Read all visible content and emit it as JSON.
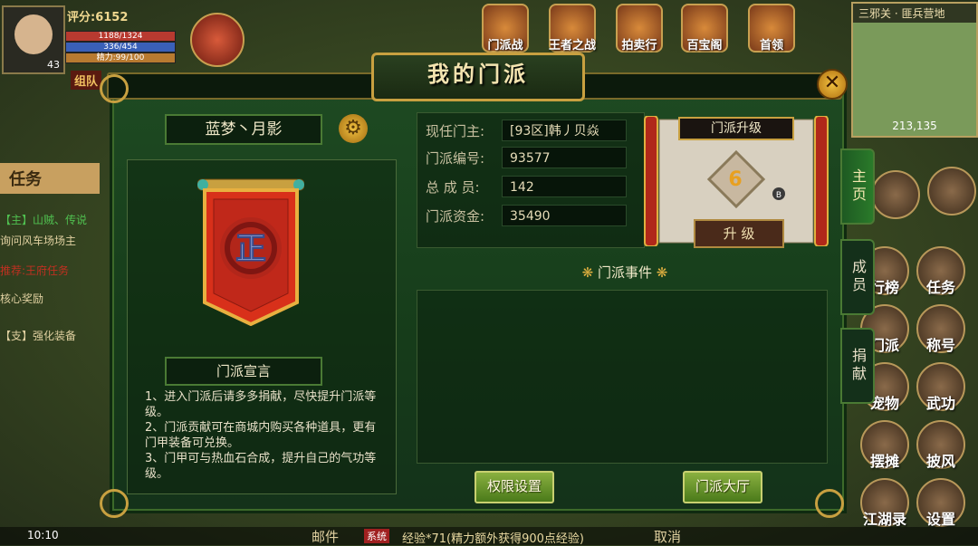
{
  "hud": {
    "player_level": "43",
    "score": "评分:6152",
    "hp": "1188/1324",
    "mp": "336/454",
    "stamina": "精力:99/100",
    "team_label": "组队",
    "top_icons": [
      "门派战",
      "王者之战",
      "拍卖行",
      "百宝阁",
      "首领"
    ],
    "location": "三邪关 · 匪兵营地",
    "coords": "213,135",
    "side_buttons": [
      "行榜",
      "任务",
      "门派",
      "称号",
      "宠物",
      "武功",
      "摆摊",
      "披风",
      "江湖录",
      "设置"
    ],
    "quest_header": "任务",
    "quest_lines": [
      "【主】山贼、传说",
      "询问风车场场主",
      "推荐:王府任务",
      "核心奖励",
      "【支】强化装备"
    ],
    "bottom_mail": "邮件",
    "bottom_system": "系统",
    "bottom_msg": "经验*71(精力额外获得900点经验)",
    "bottom_cancel": "取消",
    "clock": "10:10"
  },
  "dialog": {
    "title": "我的门派",
    "close_label": "✕",
    "sect_name": "蓝梦丶月影",
    "banner_glyph": "正",
    "declaration_title": "门派宣言",
    "declaration_lines": [
      "1、进入门派后请多多捐献，尽快提升门派等级。",
      "2、门派贡献可在商城内购买各种道具，更有门甲装备可兑换。",
      "3、门甲可与热血石合成，提升自己的气功等级。"
    ],
    "info": {
      "leader_label": "现任门主:",
      "leader_value": "[93区]韩丿贝焱",
      "id_label": "门派编号:",
      "id_value": "93577",
      "members_label": "总 成 员:",
      "members_value": "142",
      "funds_label": "门派资金:",
      "funds_value": "35490"
    },
    "upgrade": {
      "title": "门派升级",
      "level": "6",
      "button": "升 级"
    },
    "events_title": "门派事件",
    "buttons": {
      "permissions": "权限设置",
      "hall": "门派大厅"
    },
    "tabs": [
      {
        "label": "主页",
        "active": true
      },
      {
        "label": "成员",
        "active": false
      },
      {
        "label": "捐献",
        "active": false
      }
    ]
  }
}
